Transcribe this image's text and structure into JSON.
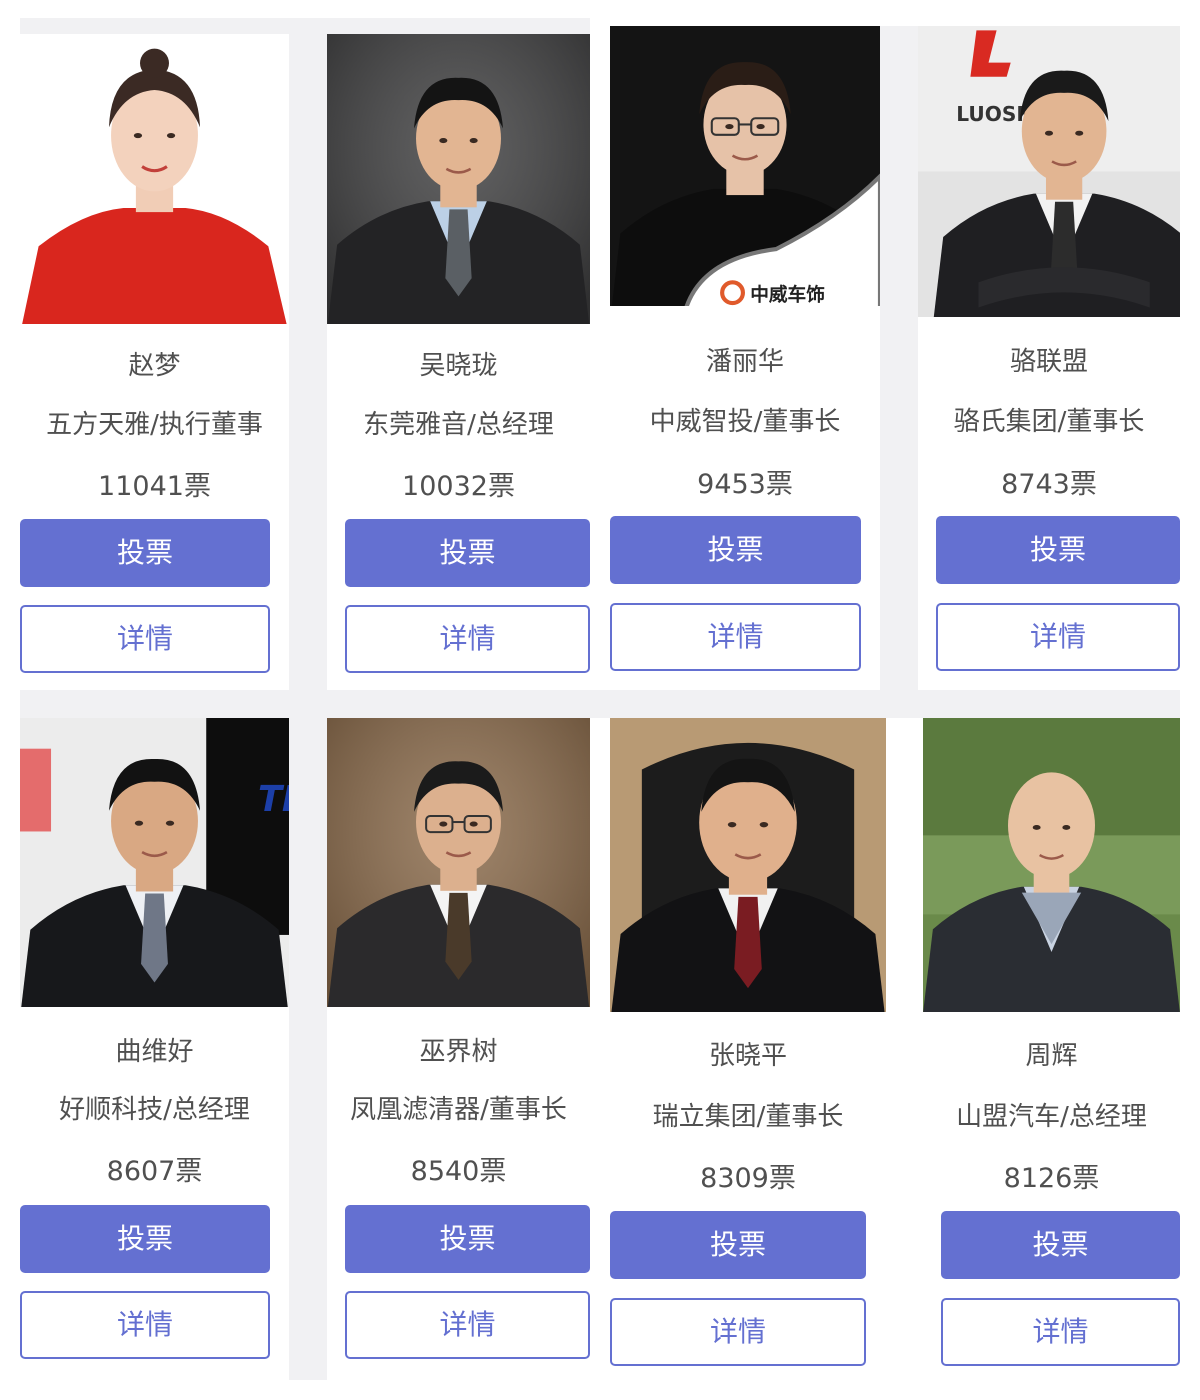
{
  "theme": {
    "accent": "#6470d1",
    "card_bg": "#ffffff",
    "page_bg": "#f1f1f3",
    "text": "#505050"
  },
  "candidates": [
    {
      "name": "赵梦",
      "title": "五方天雅/执行董事",
      "votes": "11041票",
      "vote_label": "投票",
      "detail_label": "详情",
      "photo": "portrait-woman-red-dress"
    },
    {
      "name": "吴晓珑",
      "title": "东莞雅音/总经理",
      "votes": "10032票",
      "vote_label": "投票",
      "detail_label": "详情",
      "photo": "portrait-man-dark-suit"
    },
    {
      "name": "潘丽华",
      "title": "中威智投/董事长",
      "votes": "9453票",
      "vote_label": "投票",
      "detail_label": "详情",
      "photo": "portrait-woman-black",
      "photo_caption": "中威车饰"
    },
    {
      "name": "骆联盟",
      "title": "骆氏集团/董事长",
      "votes": "8743票",
      "vote_label": "投票",
      "detail_label": "详情",
      "photo": "portrait-man-arms-crossed",
      "photo_caption": "LUOSHI"
    },
    {
      "name": "曲维好",
      "title": "好顺科技/总经理",
      "votes": "8607票",
      "vote_label": "投票",
      "detail_label": "详情",
      "photo": "portrait-man-exhibition"
    },
    {
      "name": "巫界树",
      "title": "凤凰滤清器/董事长",
      "votes": "8540票",
      "vote_label": "投票",
      "detail_label": "详情",
      "photo": "portrait-man-glasses-seated"
    },
    {
      "name": "张晓平",
      "title": "瑞立集团/董事长",
      "votes": "8309票",
      "vote_label": "投票",
      "detail_label": "详情",
      "photo": "portrait-man-leather-chair"
    },
    {
      "name": "周辉",
      "title": "山盟汽车/总经理",
      "votes": "8126票",
      "vote_label": "投票",
      "detail_label": "详情",
      "photo": "portrait-man-outdoor"
    }
  ]
}
